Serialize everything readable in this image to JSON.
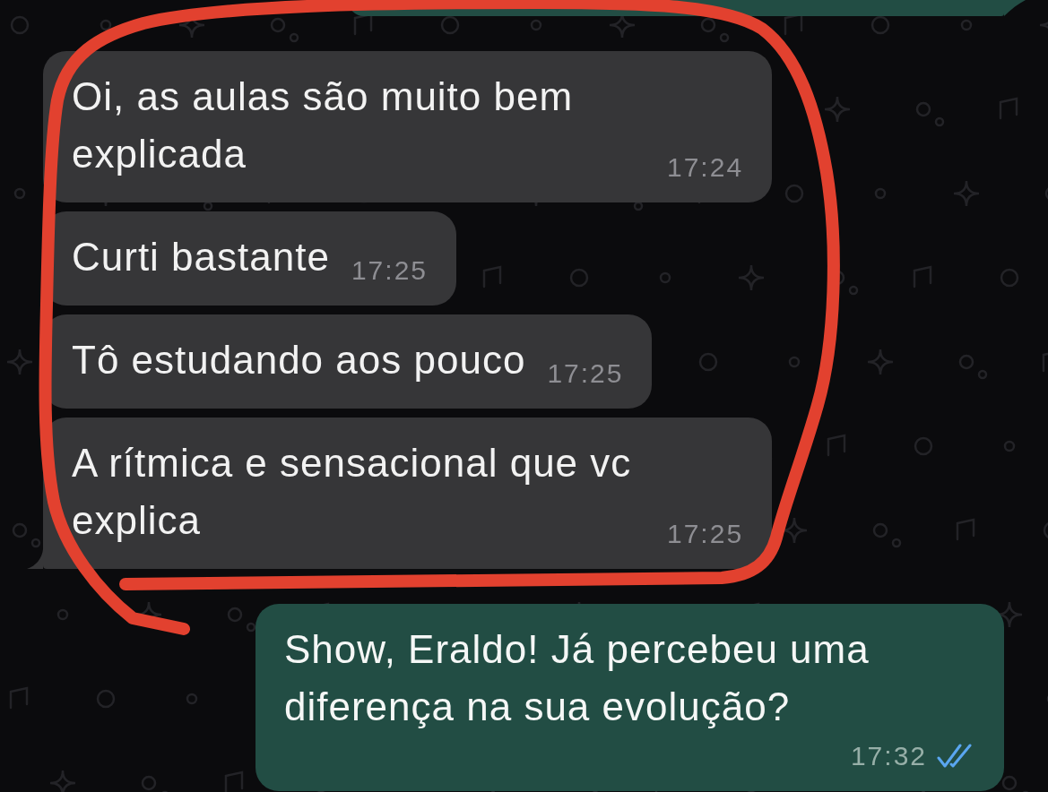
{
  "wallpaper": {
    "kind": "doodles"
  },
  "messages": [
    {
      "kind": "cutoff",
      "outgoing": true,
      "tail": true
    },
    {
      "kind": "text",
      "outgoing": false,
      "text": "Oi, as aulas são muito bem explicada",
      "time": "17:24",
      "tail": false
    },
    {
      "kind": "text",
      "outgoing": false,
      "text": "Curti bastante",
      "time": "17:25",
      "tail": false
    },
    {
      "kind": "text",
      "outgoing": false,
      "text": "Tô estudando aos pouco",
      "time": "17:25",
      "tail": false
    },
    {
      "kind": "text",
      "outgoing": false,
      "text": "A rítmica e sensacional que vc explica",
      "time": "17:25",
      "tail": true
    },
    {
      "kind": "text",
      "outgoing": true,
      "text": "Show, Eraldo! Já percebeu uma diferença na sua evolução?",
      "time": "17:32",
      "read": true,
      "tail": false
    }
  ],
  "annotation": {
    "kind": "freehand-loop"
  }
}
